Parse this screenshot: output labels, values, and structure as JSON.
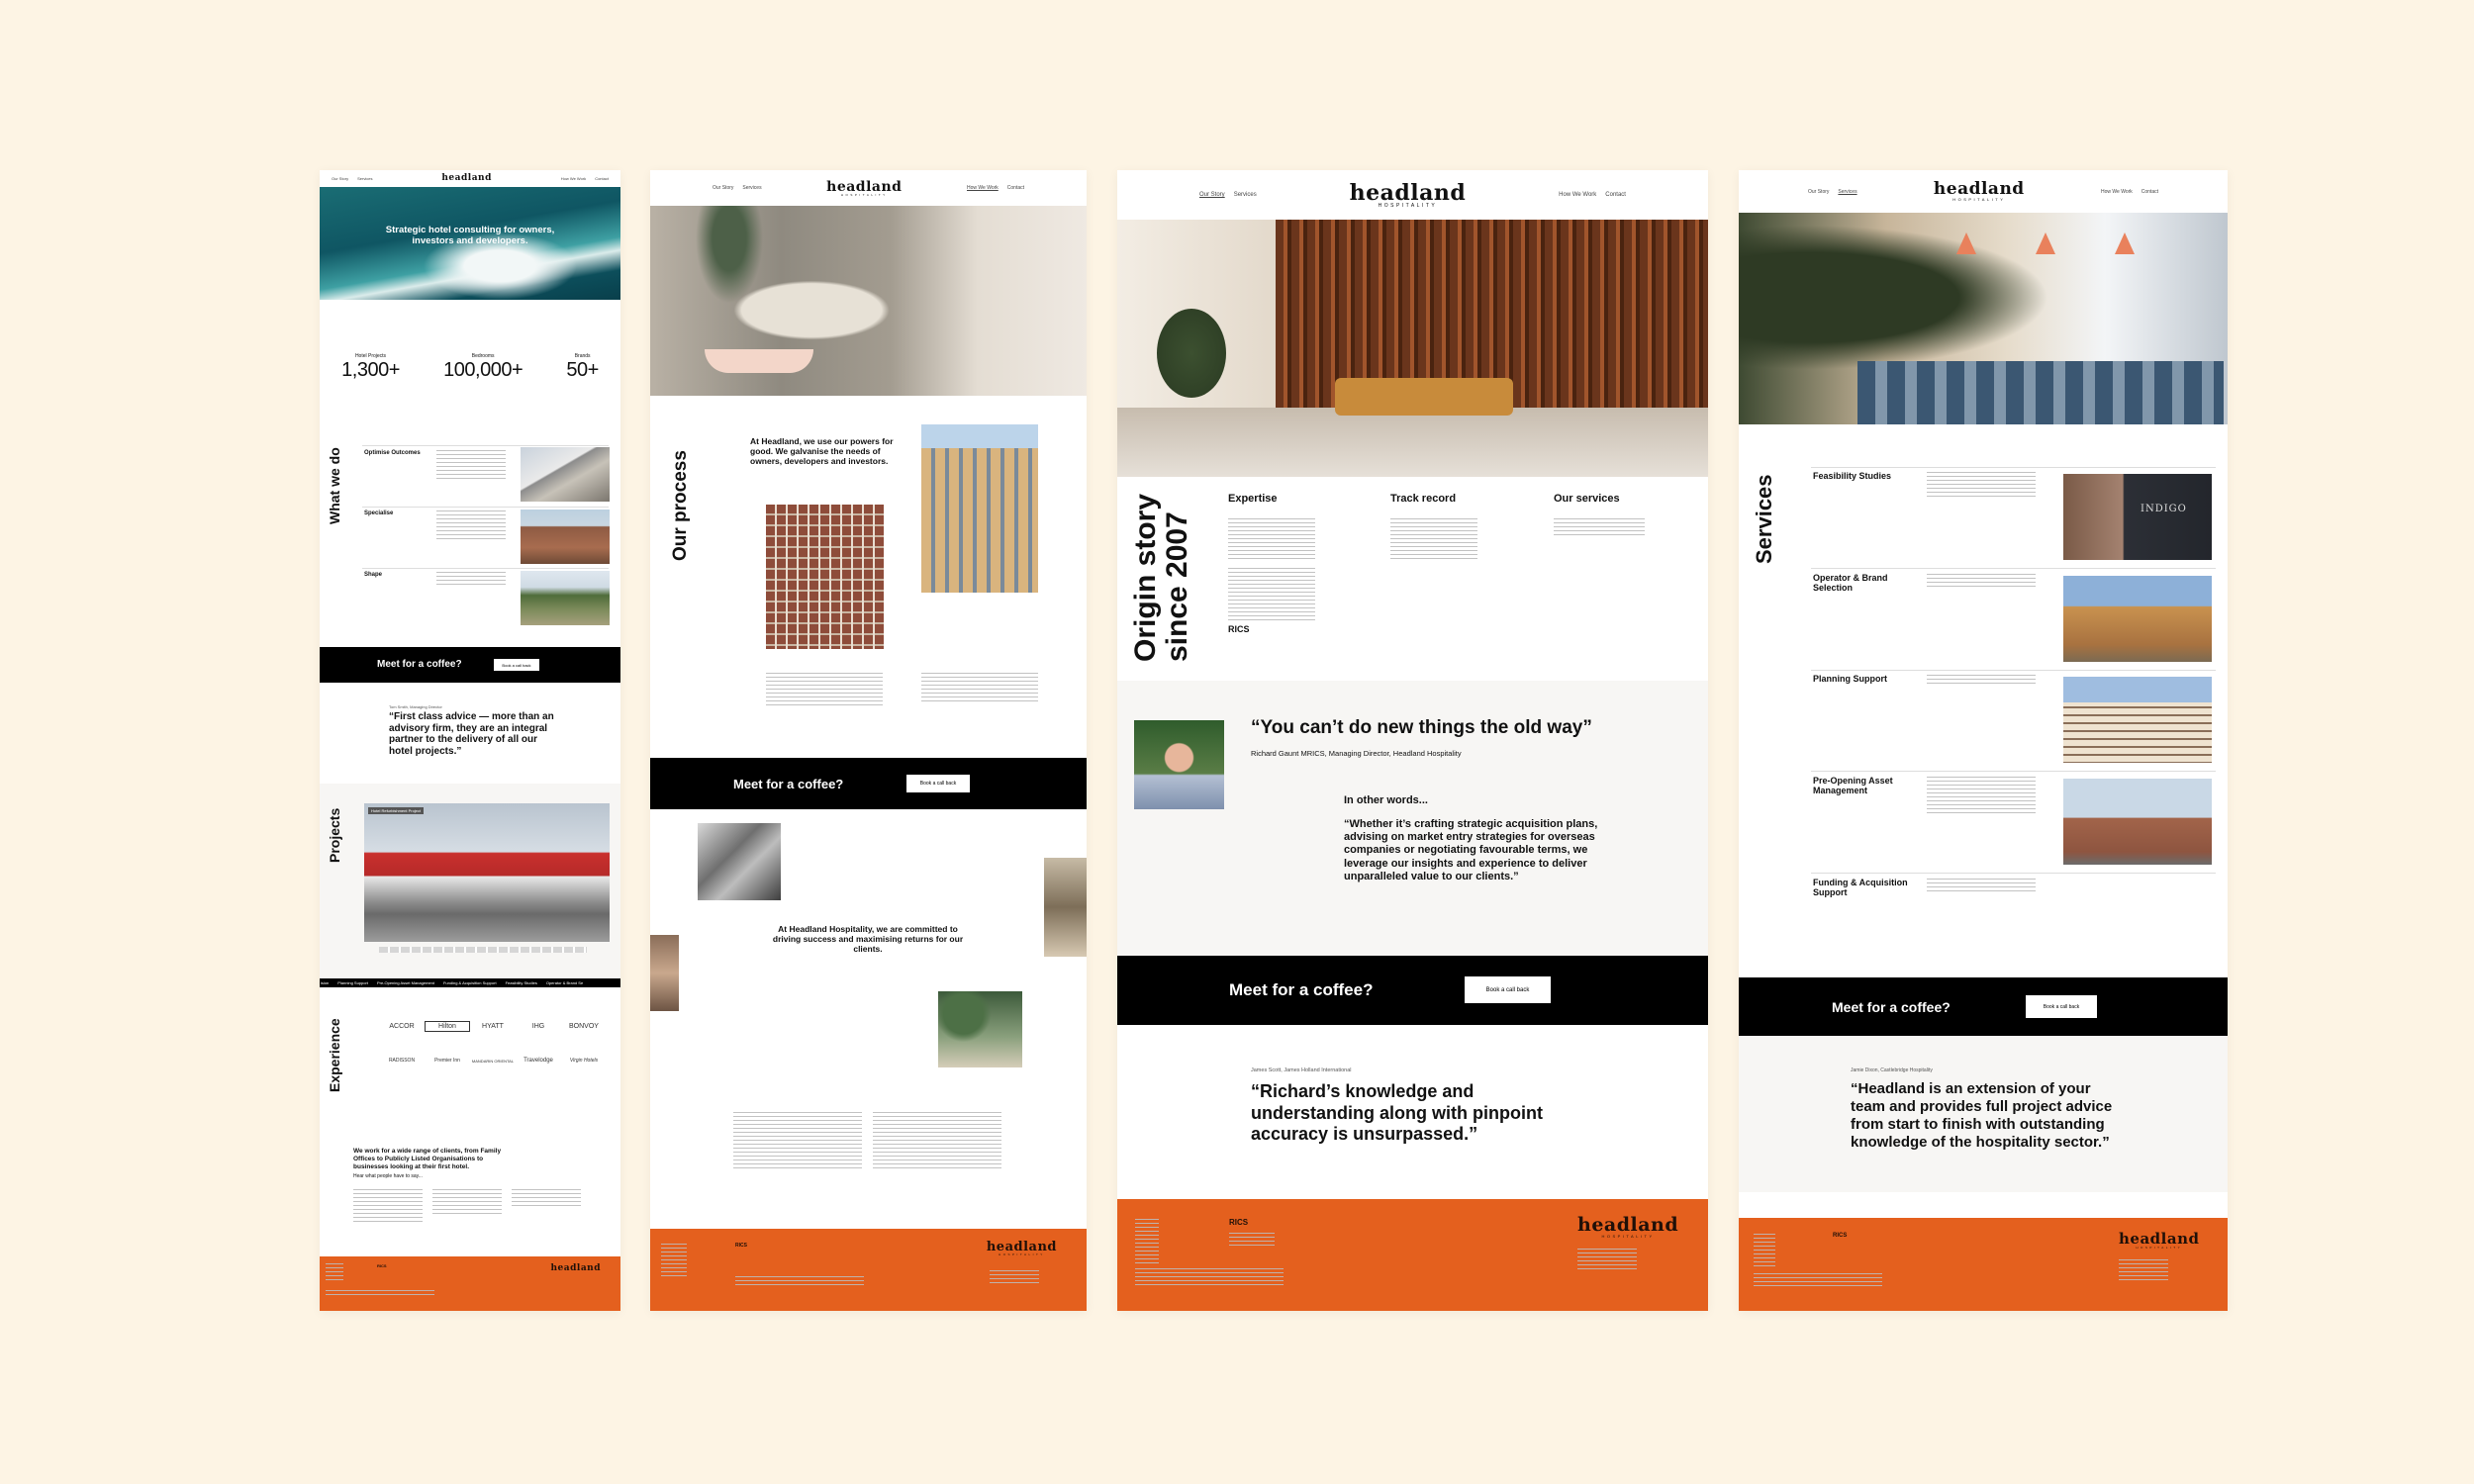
{
  "brand": {
    "logo": "headland",
    "logo_sub": "HOSPITALITY",
    "accent": "#e4601e",
    "background": "#fdf4e4"
  },
  "p1": {
    "nav_left": [
      "Our Story",
      "Services"
    ],
    "nav_right": [
      "How We Work",
      "Contact"
    ],
    "hero_text": "Strategic hotel consulting for owners, investors and developers.",
    "stats": [
      {
        "label": "Hotel Projects",
        "value": "1,300+"
      },
      {
        "label": "Bedrooms",
        "value": "100,000+"
      },
      {
        "label": "Brands",
        "value": "50+"
      }
    ],
    "what_title": "What we do",
    "what_items": [
      "Optimise Outcomes",
      "Specialise",
      "Shape"
    ],
    "cta": "Meet for a coffee?",
    "cta_button": "Book a call back",
    "quote_attr": "Tom Smith, Managing Director",
    "quote": "“First class advice — more than an advisory firm, they are an integral partner to the delivery of all our hotel projects.”",
    "projects_title": "Projects",
    "project_tag": "Hotel Refurbishment Project",
    "ticker": [
      "ision",
      "Planning Support",
      "Pre-Opening Asset Management",
      "Funding & Acquisition Support",
      "Feasibility Studies",
      "Operator & Brand Se"
    ],
    "experience_title": "Experience",
    "logos": [
      "ACCOR",
      "Hilton",
      "HYATT",
      "IHG",
      "BONVOY",
      "RADISSON",
      "Premier Inn",
      "MANDARIN ORIENTAL",
      "Travelodge",
      "Virgin Hotels"
    ],
    "clients_text": "We work for a wide range of clients, from Family Offices to Publicly Listed Organisations to businesses looking at their first hotel.",
    "clients_sub": "Hear what people have to say..."
  },
  "p2": {
    "nav_left": [
      "Our Story",
      "Services"
    ],
    "nav_right": [
      "How We Work",
      "Contact"
    ],
    "process_title": "Our process",
    "process_text": "At Headland, we use our powers for good. We galvanise the needs of owners, developers and investors.",
    "cta": "Meet for a coffee?",
    "cta_button": "Book a call back",
    "commit_text": "At Headland Hospitality, we are committed to driving success and maximising returns for our clients."
  },
  "p3": {
    "nav_left": [
      "Our Story",
      "Services"
    ],
    "nav_right": [
      "How We Work",
      "Contact"
    ],
    "origin_title_1": "Origin story",
    "origin_title_2": "since 2007",
    "columns": [
      {
        "title": "Expertise"
      },
      {
        "title": "Track record"
      },
      {
        "title": "Our services"
      }
    ],
    "rics": "RICS",
    "quote": "“You can’t do new things the old way”",
    "quote_attr": "Richard Gaunt MRICS, Managing Director, Headland Hospitality",
    "other_words": "In other words...",
    "other_quote": "“Whether it’s crafting strategic acquisition plans, advising on market entry strategies for overseas companies or negotiating favourable terms, we leverage our insights and experience to deliver unparalleled value to our clients.”",
    "cta": "Meet for a coffee?",
    "cta_button": "Book a call back",
    "testimonial_attr": "James Scott, James Holland International",
    "testimonial": "“Richard’s knowledge and understanding along with pinpoint accuracy is unsurpassed.”"
  },
  "p4": {
    "nav_left": [
      "Our Story",
      "Services"
    ],
    "nav_right": [
      "How We Work",
      "Contact"
    ],
    "services_title": "Services",
    "services": [
      "Feasibility Studies",
      "Operator & Brand Selection",
      "Planning Support",
      "Pre-Opening Asset Management",
      "Funding & Acquisition Support"
    ],
    "indigo_sign": "INDIGO",
    "cta": "Meet for a coffee?",
    "cta_button": "Book a call back",
    "testimonial_attr": "Jamie Dixon, Castlebridge Hospitality",
    "testimonial": "“Headland is an extension of your team and provides full project advice from start to finish with outstanding knowledge of the hospitality sector.”"
  }
}
